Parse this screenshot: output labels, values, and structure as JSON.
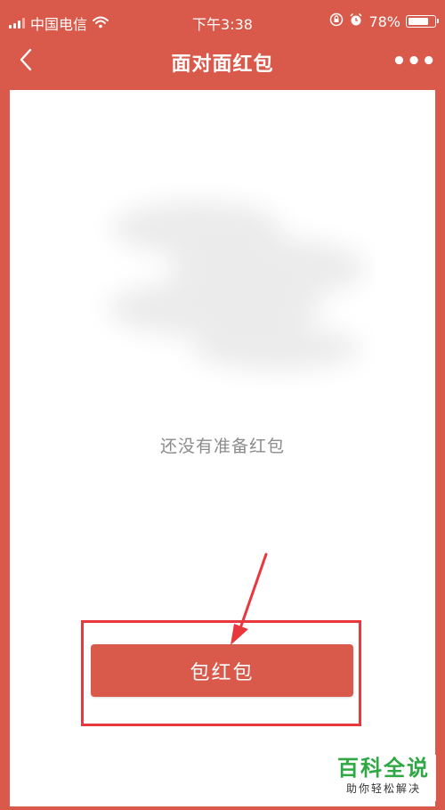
{
  "status_bar": {
    "carrier": "中国电信",
    "time": "下午3:38",
    "battery": "78%",
    "battery_level": 0.78,
    "icons": [
      "signal-icon",
      "wifi-icon",
      "rotation-lock-icon",
      "alarm-icon",
      "battery-icon"
    ]
  },
  "nav": {
    "title": "面对面红包",
    "back_icon": "chevron-left-icon",
    "more_icon": "more-dots-icon",
    "more_label": "•••"
  },
  "content": {
    "empty_text": "还没有准备红包",
    "button_label": "包红包"
  },
  "annotation": {
    "highlight_color": "#e8383d"
  },
  "watermark": {
    "title": "百科全说",
    "subtitle": "助你轻松解决"
  },
  "colors": {
    "brand_red": "#d9594a",
    "text_gray": "#8b8b8b",
    "watermark_green": "#2fa844"
  }
}
